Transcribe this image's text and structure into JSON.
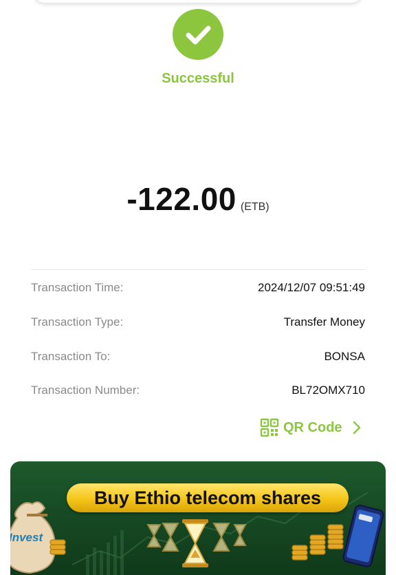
{
  "status": {
    "text": "Successful",
    "icon": "check-icon",
    "color": "#8cc63f"
  },
  "amount": {
    "value": "-122.00",
    "currency": "(ETB)"
  },
  "details": [
    {
      "label": "Transaction Time:",
      "value": "2024/12/07 09:51:49"
    },
    {
      "label": "Transaction Type:",
      "value": "Transfer Money"
    },
    {
      "label": "Transaction To:",
      "value": "BONSA"
    },
    {
      "label": "Transaction Number:",
      "value": "BL72OMX710"
    }
  ],
  "qr_link": {
    "label": "QR Code",
    "icon": "qr-code-icon",
    "chevron": "chevron-right-icon"
  },
  "banner": {
    "title": "Buy Ethio telecom shares",
    "sack_text": "Invest",
    "accent": "#f5c518"
  }
}
